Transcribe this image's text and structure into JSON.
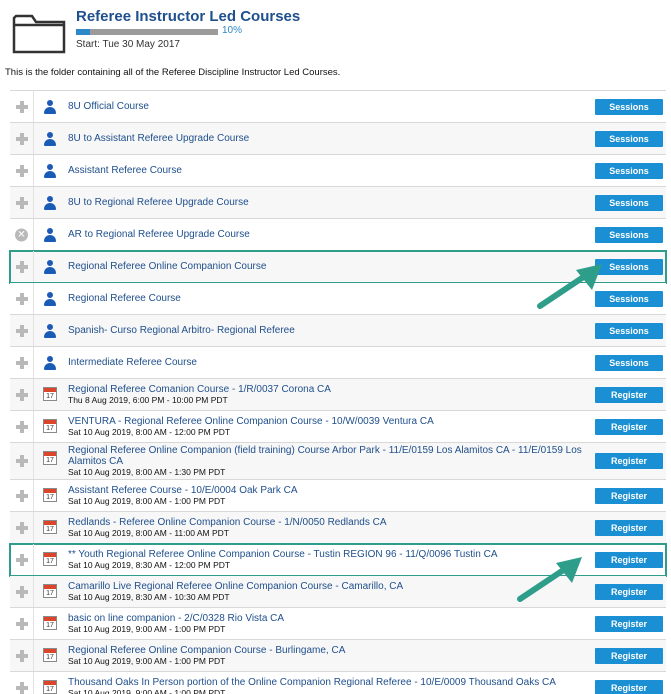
{
  "header": {
    "title": "Referee Instructor Led Courses",
    "progress": 0.1,
    "progress_label": "10%",
    "start": "Start: Tue 30 May 2017",
    "folder_icon": "folder-icon"
  },
  "description": "This is the folder containing all of the Referee Discipline Instructor Led Courses.",
  "colors": {
    "accent": "#1a8fd3",
    "link": "#1f4f8c",
    "highlight": "#2e9e8a"
  },
  "rows": [
    {
      "left": "plus",
      "icon": "person",
      "label": "8U Official Course",
      "date": "",
      "button": "Sessions",
      "hl": false
    },
    {
      "left": "plus",
      "icon": "person",
      "label": "8U to Assistant Referee Upgrade Course",
      "date": "",
      "button": "Sessions",
      "hl": false
    },
    {
      "left": "plus",
      "icon": "person",
      "label": "Assistant Referee Course",
      "date": "",
      "button": "Sessions",
      "hl": false
    },
    {
      "left": "plus",
      "icon": "person",
      "label": "8U to Regional Referee Upgrade Course",
      "date": "",
      "button": "Sessions",
      "hl": false
    },
    {
      "left": "x",
      "icon": "person",
      "label": "AR to Regional Referee Upgrade Course",
      "date": "",
      "button": "Sessions",
      "hl": false
    },
    {
      "left": "plus",
      "icon": "person",
      "label": "Regional Referee Online Companion Course",
      "date": "",
      "button": "Sessions",
      "hl": true
    },
    {
      "left": "plus",
      "icon": "person",
      "label": "Regional Referee Course",
      "date": "",
      "button": "Sessions",
      "hl": false
    },
    {
      "left": "plus",
      "icon": "person",
      "label": "Spanish- Curso Regional Arbitro- Regional Referee",
      "date": "",
      "button": "Sessions",
      "hl": false
    },
    {
      "left": "plus",
      "icon": "person",
      "label": "Intermediate Referee Course",
      "date": "",
      "button": "Sessions",
      "hl": false
    },
    {
      "left": "plus",
      "icon": "calendar",
      "label": "Regional Referee Comanion Course - 1/R/0037 Corona CA",
      "date": "Thu 8 Aug 2019, 6:00 PM - 10:00 PM PDT",
      "button": "Register",
      "hl": false
    },
    {
      "left": "plus",
      "icon": "calendar",
      "label": "VENTURA - Regional Referee Online Companion Course - 10/W/0039 Ventura CA",
      "date": "Sat 10 Aug 2019, 8:00 AM - 12:00 PM PDT",
      "button": "Register",
      "hl": false
    },
    {
      "left": "plus",
      "icon": "calendar",
      "label": "Regional Referee Online Companion (field training) Course Arbor Park - 11/E/0159 Los Alamitos CA - 11/E/0159 Los Alamitos CA",
      "date": "Sat 10 Aug 2019, 8:00 AM - 1:30 PM PDT",
      "button": "Register",
      "hl": false
    },
    {
      "left": "plus",
      "icon": "calendar",
      "label": "Assistant Referee Course - 10/E/0004 Oak Park CA",
      "date": "Sat 10 Aug 2019, 8:00 AM - 1:00 PM PDT",
      "button": "Register",
      "hl": false
    },
    {
      "left": "plus",
      "icon": "calendar",
      "label": "Redlands - Referee Online Companion Course - 1/N/0050 Redlands CA",
      "date": "Sat 10 Aug 2019, 8:00 AM - 11:00 AM PDT",
      "button": "Register",
      "hl": false
    },
    {
      "left": "plus",
      "icon": "calendar",
      "label": "** Youth Regional Referee Online Companion Course - Tustin REGION 96 - 11/Q/0096 Tustin CA",
      "date": "Sat 10 Aug 2019, 8:30 AM - 12:00 PM PDT",
      "button": "Register",
      "hl": true
    },
    {
      "left": "plus",
      "icon": "calendar",
      "label": "Camarillo Live Regional Referee Online Companion Course - Camarillo, CA",
      "date": "Sat 10 Aug 2019, 8:30 AM - 10:30 AM PDT",
      "button": "Register",
      "hl": false
    },
    {
      "left": "plus",
      "icon": "calendar",
      "label": "basic on line companion - 2/C/0328 Rio Vista CA",
      "date": "Sat 10 Aug 2019, 9:00 AM - 1:00 PM PDT",
      "button": "Register",
      "hl": false
    },
    {
      "left": "plus",
      "icon": "calendar",
      "label": "Regional Referee Online Companion Course - Burlingame, CA",
      "date": "Sat 10 Aug 2019, 9:00 AM - 1:00 PM PDT",
      "button": "Register",
      "hl": false
    },
    {
      "left": "plus",
      "icon": "calendar",
      "label": "Thousand Oaks In Person portion of the Online Companion Regional Referee - 10/E/0009 Thousand Oaks CA",
      "date": "Sat 10 Aug 2019, 9:00 AM - 1:00 PM PDT",
      "button": "Register",
      "hl": false
    }
  ]
}
